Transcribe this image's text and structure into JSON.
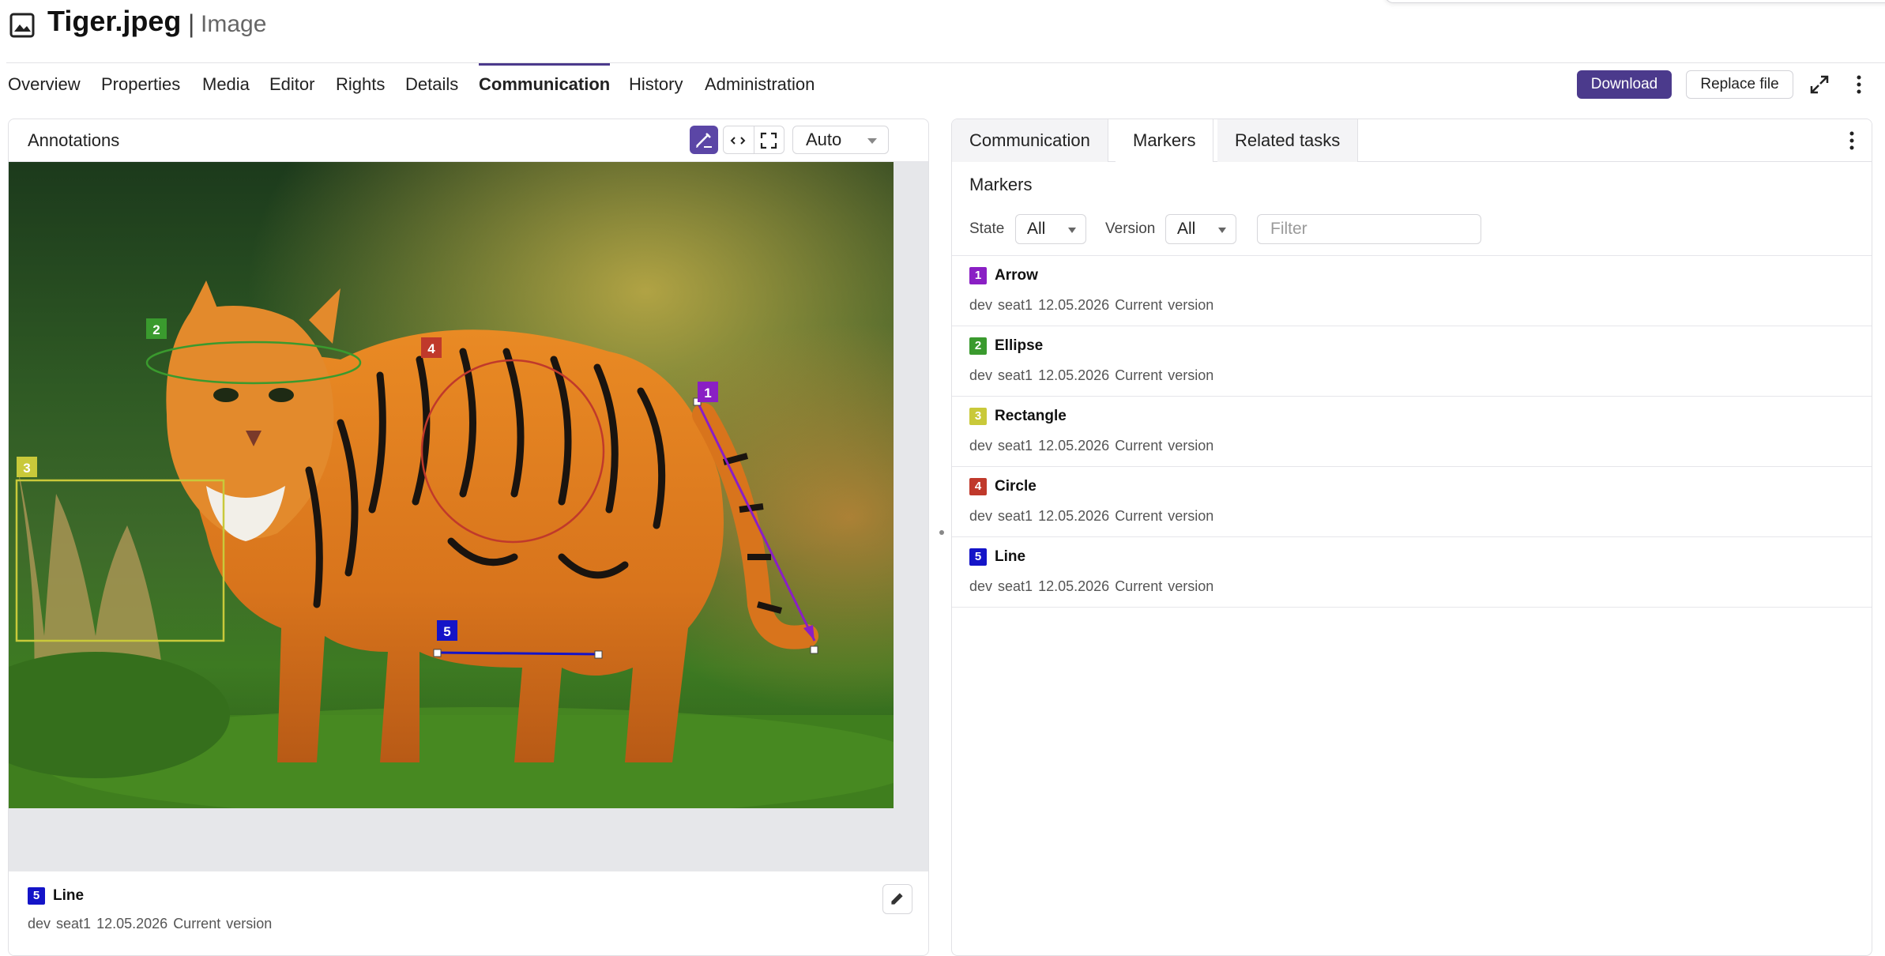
{
  "header": {
    "title": "Tiger.jpeg",
    "separator": "|",
    "subtitle": "Image",
    "file_icon": "image-icon"
  },
  "nav": {
    "tabs": [
      {
        "label": "Overview"
      },
      {
        "label": "Properties"
      },
      {
        "label": "Media"
      },
      {
        "label": "Editor"
      },
      {
        "label": "Rights"
      },
      {
        "label": "Details"
      },
      {
        "label": "Communication",
        "active": true
      },
      {
        "label": "History"
      },
      {
        "label": "Administration"
      }
    ],
    "download_label": "Download",
    "replace_label": "Replace file",
    "accent_color": "#4b3a8c"
  },
  "annotations_panel": {
    "title": "Annotations",
    "zoom": "Auto",
    "tools": [
      "draw-annotation-icon",
      "fit-width-icon",
      "fullscreen-icon"
    ],
    "selected": {
      "number": "5",
      "name": "Line",
      "user": "dev seat1",
      "date": "12.05.2026",
      "version": "Current version",
      "color": "#1414c8"
    }
  },
  "image": {
    "description_icon": "tiger-photo",
    "annotations": [
      {
        "number": "1",
        "type": "arrow",
        "color": "#8a1fc4"
      },
      {
        "number": "2",
        "type": "ellipse",
        "color": "#3a9a2e"
      },
      {
        "number": "3",
        "type": "rectangle",
        "color": "#c9c93a"
      },
      {
        "number": "4",
        "type": "circle",
        "color": "#c0392b"
      },
      {
        "number": "5",
        "type": "line",
        "color": "#1414c8"
      }
    ]
  },
  "right_panel": {
    "tabs": [
      {
        "label": "Communication"
      },
      {
        "label": "Markers",
        "active": true
      },
      {
        "label": "Related tasks"
      }
    ],
    "subtitle": "Markers",
    "filters": {
      "state_label": "State",
      "state_value": "All",
      "version_label": "Version",
      "version_value": "All",
      "filter_placeholder": "Filter"
    },
    "markers": [
      {
        "number": "1",
        "name": "Arrow",
        "user": "dev seat1",
        "date": "12.05.2026",
        "version": "Current version",
        "color": "#8a1fc4"
      },
      {
        "number": "2",
        "name": "Ellipse",
        "user": "dev seat1",
        "date": "12.05.2026",
        "version": "Current version",
        "color": "#3a9a2e"
      },
      {
        "number": "3",
        "name": "Rectangle",
        "user": "dev seat1",
        "date": "12.05.2026",
        "version": "Current version",
        "color": "#c9c93a"
      },
      {
        "number": "4",
        "name": "Circle",
        "user": "dev seat1",
        "date": "12.05.2026",
        "version": "Current version",
        "color": "#c0392b"
      },
      {
        "number": "5",
        "name": "Line",
        "user": "dev seat1",
        "date": "12.05.2026",
        "version": "Current version",
        "color": "#1414c8"
      }
    ]
  }
}
